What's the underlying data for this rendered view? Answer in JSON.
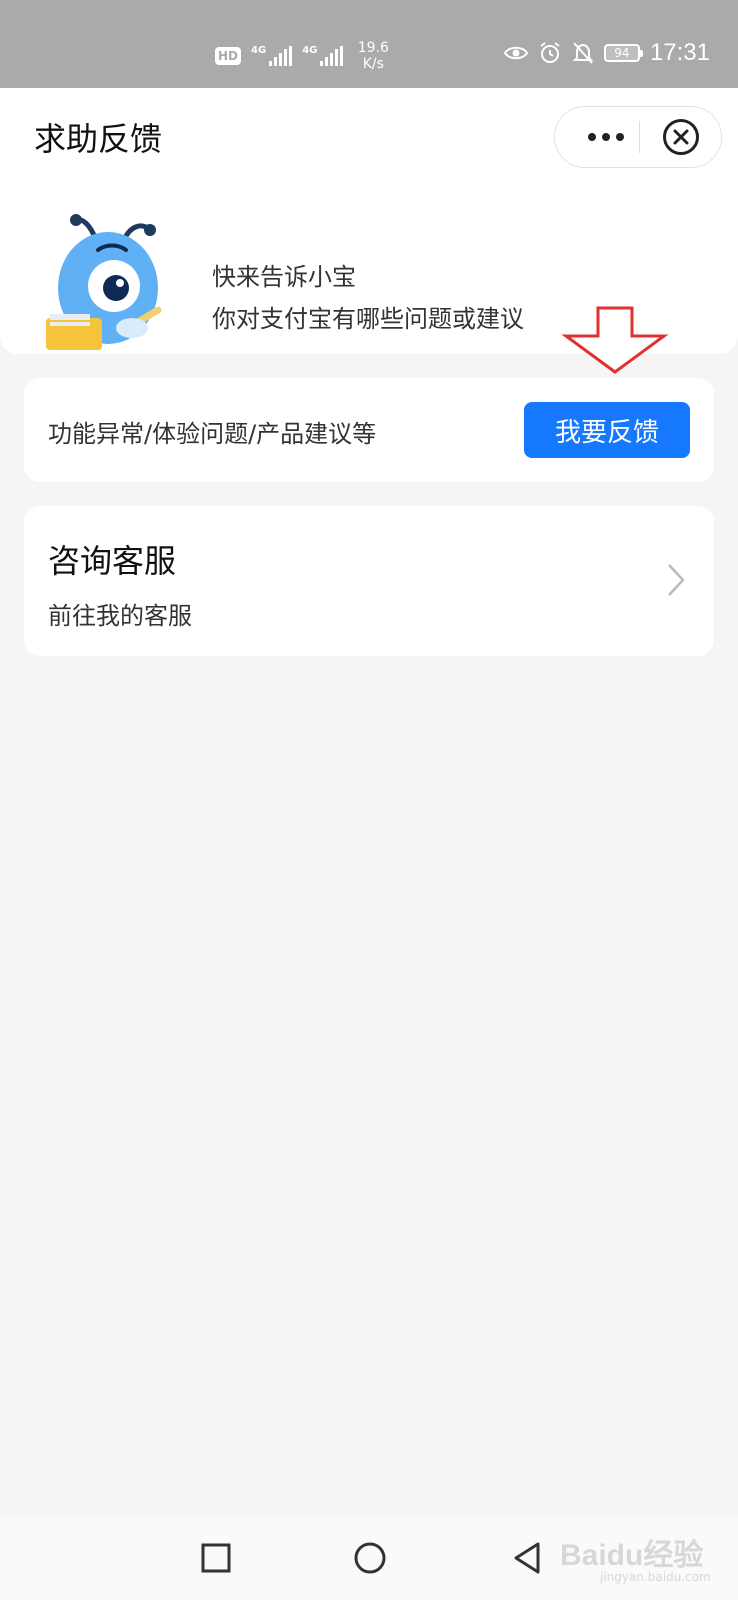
{
  "status_bar": {
    "hd": "HD",
    "network1": "4G",
    "network2": "4G",
    "speed_value": "19.6",
    "speed_unit": "K/s",
    "battery": "94",
    "time": "17:31"
  },
  "header": {
    "title": "求助反馈"
  },
  "banner": {
    "line1": "快来告诉小宝",
    "line2": "你对支付宝有哪些问题或建议"
  },
  "feedback": {
    "description": "功能异常/体验问题/产品建议等",
    "button_label": "我要反馈"
  },
  "customer_service": {
    "title": "咨询客服",
    "subtitle": "前往我的客服"
  },
  "watermark": {
    "main": "Baidu经验",
    "sub": "jingyan.baidu.com"
  },
  "colors": {
    "primary": "#1677ff",
    "annotation_arrow": "#e03030",
    "mascot": "#5fb0f5"
  }
}
